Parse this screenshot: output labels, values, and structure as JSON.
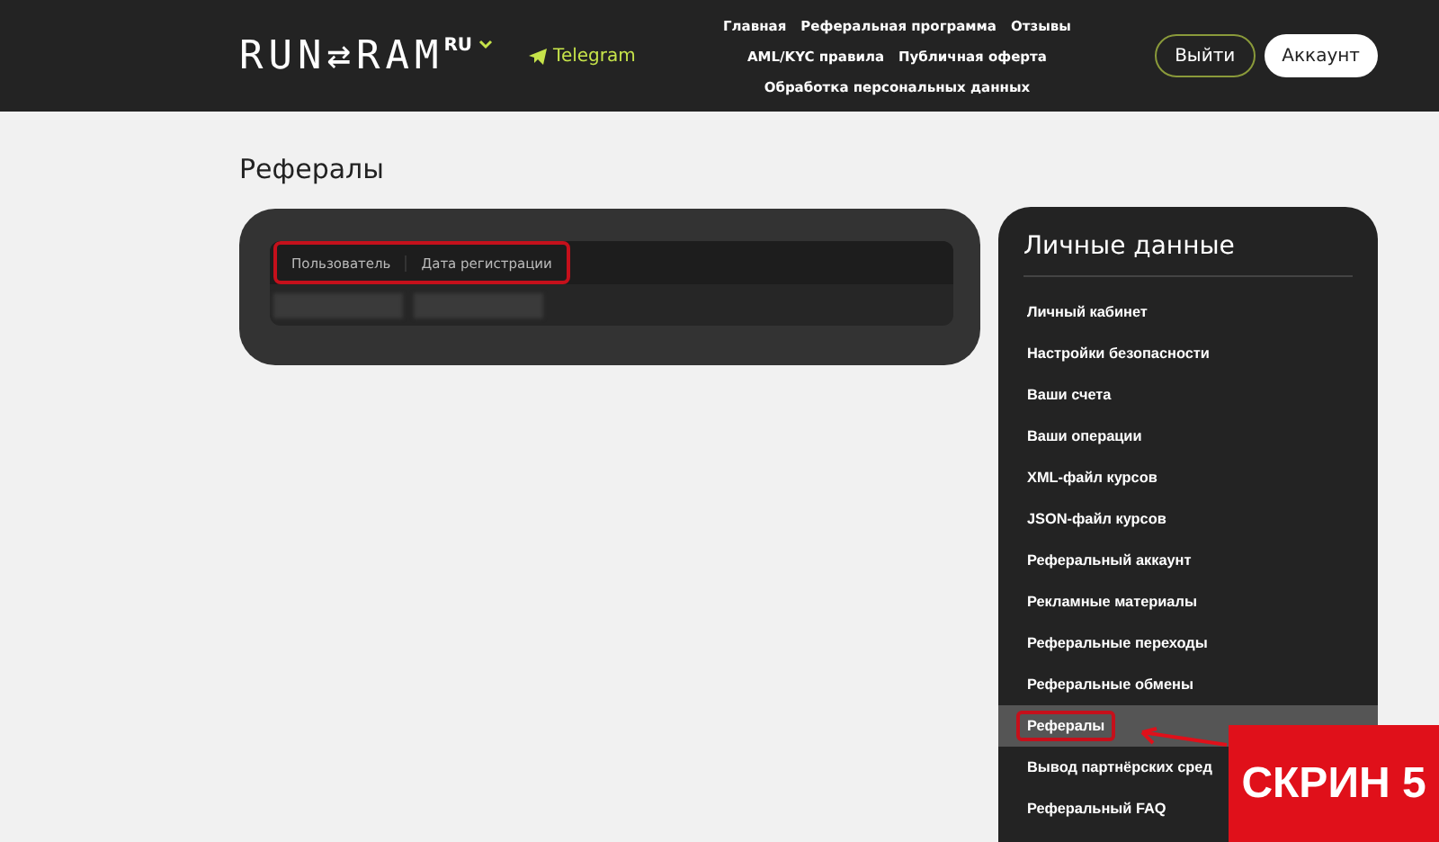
{
  "header": {
    "logo": "RUN⇄RAM",
    "language": "RU",
    "telegram": "Telegram",
    "nav": [
      {
        "label": "Главная"
      },
      {
        "label": "Реферальная программа"
      },
      {
        "label": "Отзывы"
      },
      {
        "label": "AML/KYC правила"
      },
      {
        "label": "Публичная оферта"
      },
      {
        "label": "Обработка персональных данных"
      }
    ],
    "logout": "Выйти",
    "account": "Аккаунт"
  },
  "page_title": "Рефералы",
  "table": {
    "columns": [
      "Пользователь",
      "Дата регистрации"
    ]
  },
  "sidebar": {
    "title": "Личные данные",
    "items": [
      {
        "label": "Личный кабинет",
        "selected": false
      },
      {
        "label": "Настройки безопасности",
        "selected": false
      },
      {
        "label": "Ваши счета",
        "selected": false
      },
      {
        "label": "Ваши операции",
        "selected": false
      },
      {
        "label": "XML-файл курсов",
        "selected": false
      },
      {
        "label": "JSON-файл курсов",
        "selected": false
      },
      {
        "label": "Реферальный аккаунт",
        "selected": false
      },
      {
        "label": "Рекламные материалы",
        "selected": false
      },
      {
        "label": "Реферальные переходы",
        "selected": false
      },
      {
        "label": "Реферальные обмены",
        "selected": false
      },
      {
        "label": "Рефералы",
        "selected": true
      },
      {
        "label": "Вывод партнёрских сред",
        "selected": false
      },
      {
        "label": "Реферальный FAQ",
        "selected": false
      }
    ]
  },
  "annotation": {
    "label": "СКРИН 5"
  }
}
